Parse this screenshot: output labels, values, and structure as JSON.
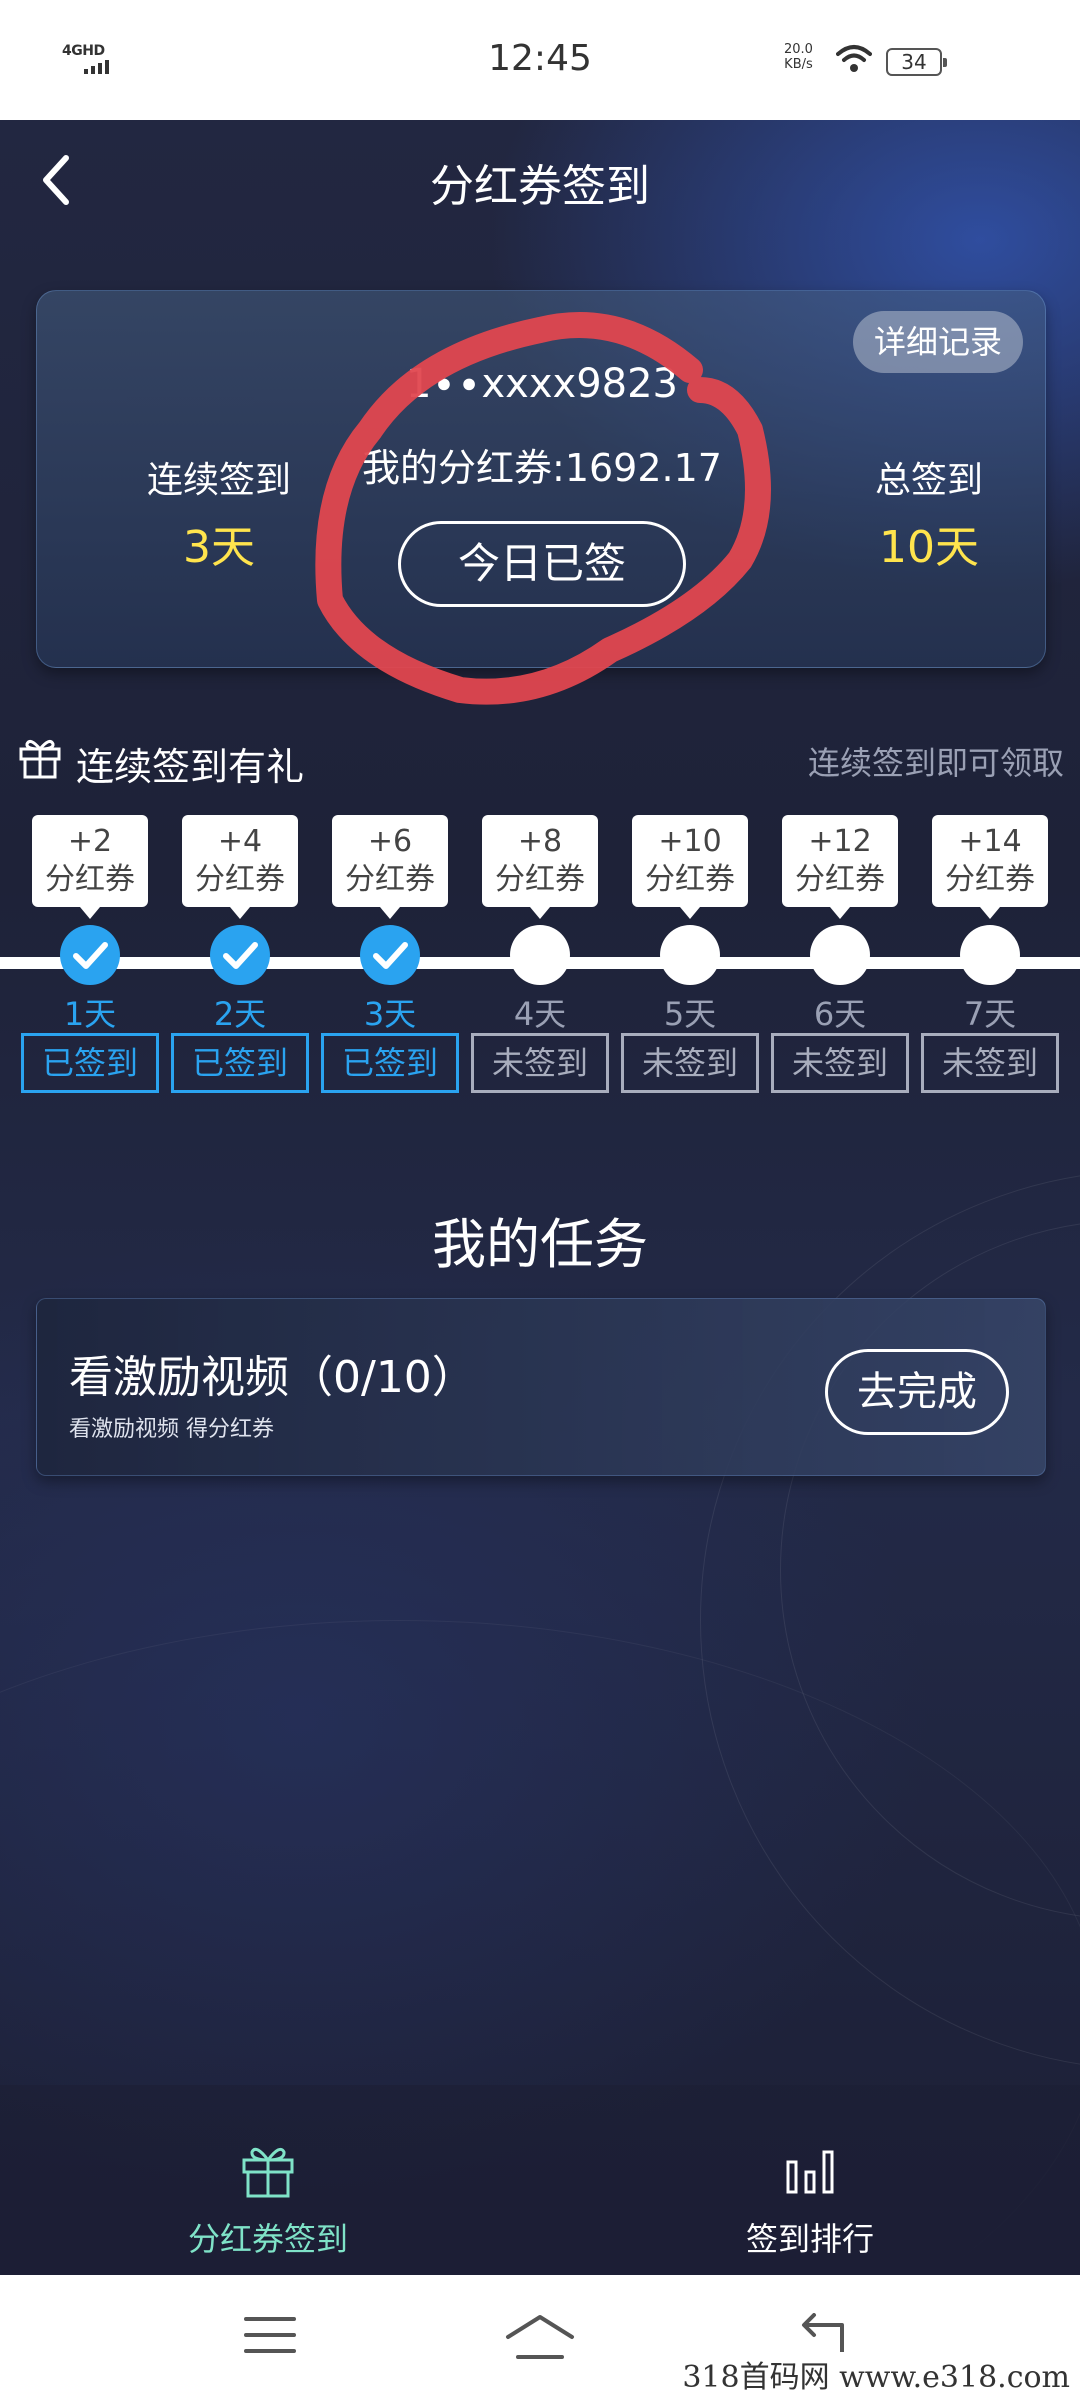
{
  "status_bar": {
    "network": "4GHD",
    "time": "12:45",
    "speed_value": "20.0",
    "speed_unit": "KB/s",
    "battery": "34",
    "icons": [
      "signal-icon",
      "wifi-icon",
      "battery-icon"
    ]
  },
  "header": {
    "title": "分红券签到",
    "back_icon": "back-arrow-icon"
  },
  "summary": {
    "detail_button": "详细记录",
    "streak_label": "连续签到",
    "streak_value": "3天",
    "total_label": "总签到",
    "total_value": "10天",
    "account": "1∙∙xxxx9823",
    "balance": "我的分红券:1692.17",
    "signed_button": "今日已签",
    "value_color": "#ffe44d"
  },
  "continuous": {
    "title": "连续签到有礼",
    "hint": "连续签到即可领取",
    "days": [
      {
        "reward": "+2",
        "unit": "分红券",
        "day": "1天",
        "status": "已签到",
        "done": true
      },
      {
        "reward": "+4",
        "unit": "分红券",
        "day": "2天",
        "status": "已签到",
        "done": true
      },
      {
        "reward": "+6",
        "unit": "分红券",
        "day": "3天",
        "status": "已签到",
        "done": true
      },
      {
        "reward": "+8",
        "unit": "分红券",
        "day": "4天",
        "status": "未签到",
        "done": false
      },
      {
        "reward": "+10",
        "unit": "分红券",
        "day": "5天",
        "status": "未签到",
        "done": false
      },
      {
        "reward": "+12",
        "unit": "分红券",
        "day": "6天",
        "status": "未签到",
        "done": false
      },
      {
        "reward": "+14",
        "unit": "分红券",
        "day": "7天",
        "status": "未签到",
        "done": false
      }
    ],
    "done_color": "#2aa3f0"
  },
  "tasks": {
    "title": "我的任务",
    "items": [
      {
        "title": "看激励视频（0/10）",
        "subtitle": "看激励视频 得分红券",
        "button": "去完成"
      }
    ]
  },
  "tabbar": {
    "tabs": [
      {
        "label": "分红券签到",
        "icon": "gift-icon",
        "active": true
      },
      {
        "label": "签到排行",
        "icon": "bar-chart-icon",
        "active": false
      }
    ],
    "active_color": "#7fe3c8"
  },
  "system_nav": {
    "icons": [
      "menu-icon",
      "home-icon",
      "back-icon"
    ]
  },
  "watermark": "318首码网  www.e318.com"
}
